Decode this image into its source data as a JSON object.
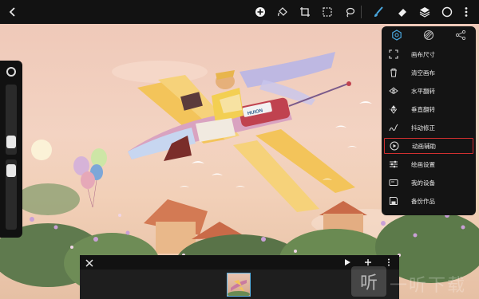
{
  "toolbar": {
    "back_icon": "chevron-left-icon",
    "tools": [
      "add-icon",
      "fill-bucket-icon",
      "crop-icon",
      "selection-icon",
      "lasso-icon",
      "brush-icon",
      "eraser-icon",
      "layers-icon",
      "color-circle-icon",
      "more-vertical-icon"
    ]
  },
  "menu": {
    "tabs": [
      "settings-hex-icon",
      "brush-texture-icon",
      "share-icon"
    ],
    "items": [
      {
        "label": "画布尺寸",
        "icon": "canvas-size-icon"
      },
      {
        "label": "清空画布",
        "icon": "trash-icon"
      },
      {
        "label": "水平翻转",
        "icon": "flip-horizontal-icon"
      },
      {
        "label": "垂直翻转",
        "icon": "flip-vertical-icon"
      },
      {
        "label": "抖动修正",
        "icon": "stabilizer-icon"
      },
      {
        "label": "动画辅助",
        "icon": "play-circle-icon",
        "active": true
      },
      {
        "label": "绘画设置",
        "icon": "sliders-icon"
      },
      {
        "label": "我的设备",
        "icon": "device-icon"
      },
      {
        "label": "备份作品",
        "icon": "save-icon"
      }
    ]
  },
  "artwork": {
    "plane_logo": "HUION"
  },
  "bottom_panel": {
    "controls": [
      "play-icon",
      "add-icon",
      "more-vertical-icon"
    ]
  },
  "watermark": {
    "box_char": "听",
    "text": "一听下载"
  },
  "colors": {
    "accent_active": "#d03030",
    "brush_blue": "#4aa8e0",
    "frame_border": "#5ab0e0"
  }
}
